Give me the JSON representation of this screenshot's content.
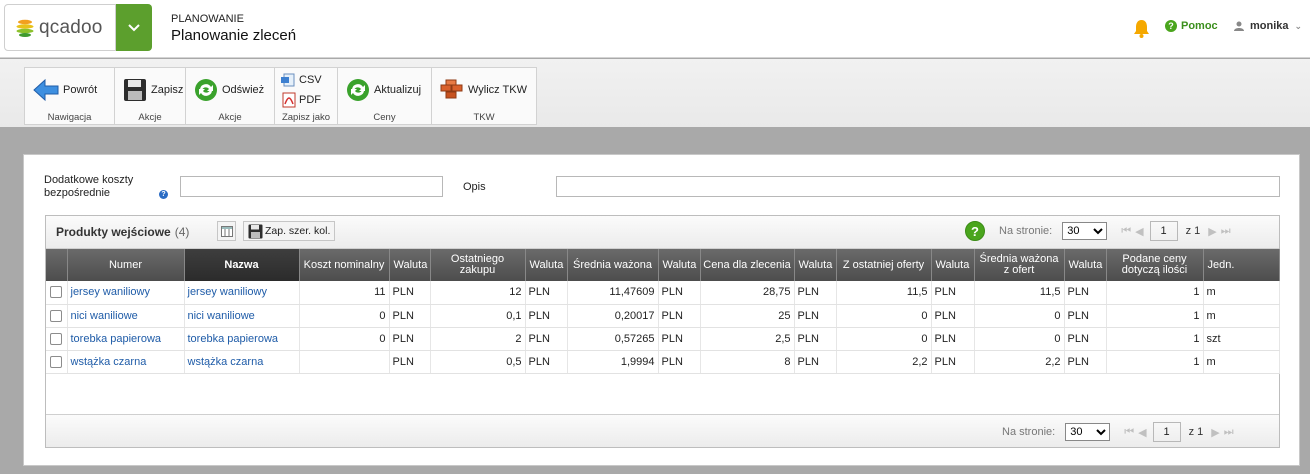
{
  "header": {
    "logo_text": "qcadoo",
    "module": "PLANOWANIE",
    "page_title": "Planowanie zleceń",
    "help_label": "Pomoc",
    "user_name": "monika"
  },
  "ribbon": {
    "groups": [
      {
        "label": "Nawigacja",
        "buttons": [
          "Powrót"
        ]
      },
      {
        "label": "Akcje",
        "buttons": [
          "Zapisz"
        ]
      },
      {
        "label": "Akcje",
        "buttons": [
          "Odśwież"
        ]
      },
      {
        "label": "Zapisz jako",
        "buttons": [
          "CSV",
          "PDF"
        ]
      },
      {
        "label": "Ceny",
        "buttons": [
          "Aktualizuj"
        ]
      },
      {
        "label": "TKW",
        "buttons": [
          "Wylicz TKW"
        ]
      }
    ]
  },
  "form": {
    "koszty_label": "Dodatkowe koszty bezpośrednie",
    "koszty_value": "",
    "opis_label": "Opis",
    "opis_value": ""
  },
  "grid": {
    "title": "Produkty wejściowe",
    "count": "(4)",
    "save_cols_label": "Zap. szer. kol.",
    "per_page_label": "Na stronie:",
    "per_page_value": "30",
    "page_value": "1",
    "page_of": "z 1",
    "columns": [
      "",
      "Numer",
      "Nazwa",
      "Koszt nominalny",
      "Waluta",
      "Ostatniego zakupu",
      "Waluta",
      "Średnia ważona",
      "Waluta",
      "Cena dla zlecenia",
      "Waluta",
      "Z ostatniej oferty",
      "Waluta",
      "Średnia ważona z ofert",
      "Waluta",
      "Podane ceny dotyczą ilości",
      "Jedn."
    ],
    "rows": [
      [
        "jersey waniliowy",
        "jersey waniliowy",
        "11",
        "PLN",
        "12",
        "PLN",
        "11,47609",
        "PLN",
        "28,75",
        "PLN",
        "11,5",
        "PLN",
        "11,5",
        "PLN",
        "1",
        "m"
      ],
      [
        "nici waniliowe",
        "nici waniliowe",
        "0",
        "PLN",
        "0,1",
        "PLN",
        "0,20017",
        "PLN",
        "25",
        "PLN",
        "0",
        "PLN",
        "0",
        "PLN",
        "1",
        "m"
      ],
      [
        "torebka papierowa",
        "torebka papierowa",
        "0",
        "PLN",
        "2",
        "PLN",
        "0,57265",
        "PLN",
        "2,5",
        "PLN",
        "0",
        "PLN",
        "0",
        "PLN",
        "1",
        "szt"
      ],
      [
        "wstążka czarna",
        "wstążka czarna",
        "",
        "PLN",
        "0,5",
        "PLN",
        "1,9994",
        "PLN",
        "8",
        "PLN",
        "2,2",
        "PLN",
        "2,2",
        "PLN",
        "1",
        "m"
      ]
    ]
  },
  "colors": {
    "brand_green": "#5c9f2d",
    "link_blue": "#1f5ca8",
    "header_gray": "#4d4d4d"
  }
}
